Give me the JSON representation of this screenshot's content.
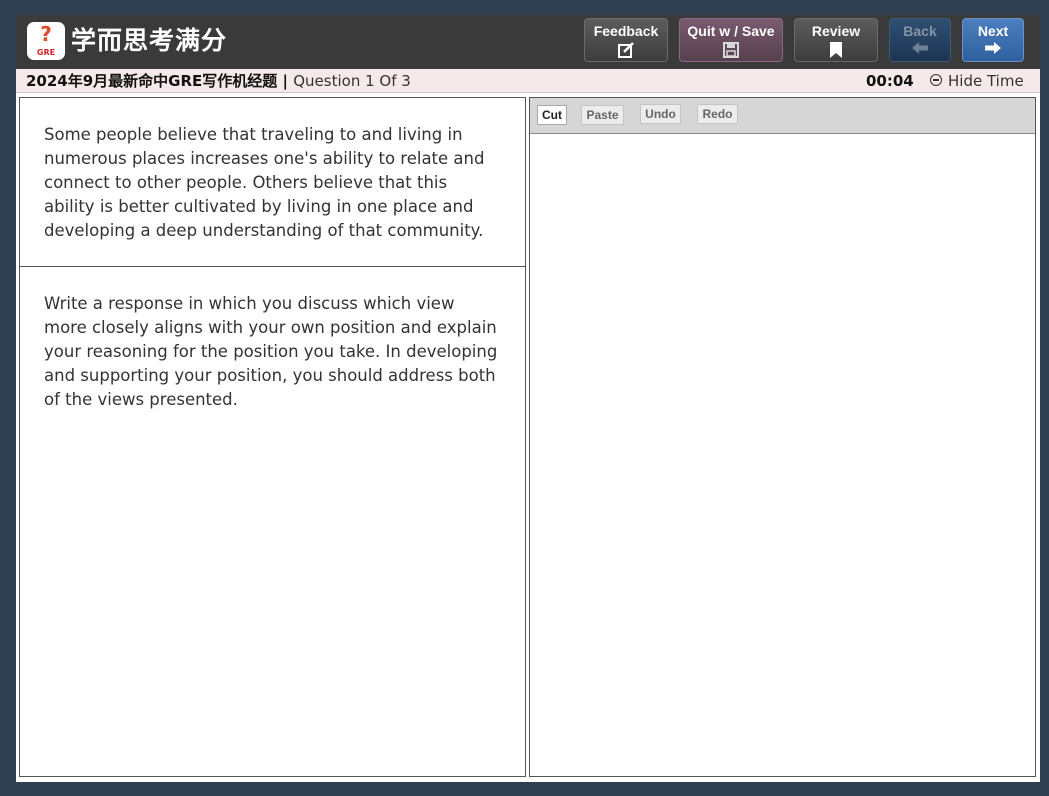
{
  "header": {
    "brand": "学而思考满分",
    "logo_mark": "?",
    "logo_text": "GRE",
    "buttons": {
      "feedback": "Feedback",
      "quit_save": "Quit w / Save",
      "review": "Review",
      "back": "Back",
      "next": "Next"
    }
  },
  "subheader": {
    "test_title": "2024年9月最新命中GRE写作机经题",
    "separator": " | ",
    "question_label": "Question 1 Of 3",
    "timer": "00:04",
    "hide_time": "Hide Time"
  },
  "prompt": {
    "statement": "Some people believe that traveling to and living in numerous places increases one's ability to relate and connect to other people. Others believe that this ability is better cultivated by living in one place and developing a deep understanding of that community.",
    "instructions": "Write a response in which you discuss which view more closely aligns with your own position and explain your reasoning for the position you take. In developing and supporting your position, you should address both of the views presented."
  },
  "editor": {
    "buttons": {
      "cut": "Cut",
      "paste": "Paste",
      "undo": "Undo",
      "redo": "Redo"
    },
    "content": ""
  },
  "icons": {
    "feedback": "edit-icon",
    "quit_save": "save-icon",
    "review": "bookmark-icon",
    "back": "arrow-left-icon",
    "next": "arrow-right-icon",
    "hide_time": "minus-circle-icon"
  },
  "colors": {
    "page_bg": "#2f3f50",
    "topbar": "#3a3a3a",
    "subbar": "#f6e9ea",
    "next_button": "#3a6fb0"
  }
}
